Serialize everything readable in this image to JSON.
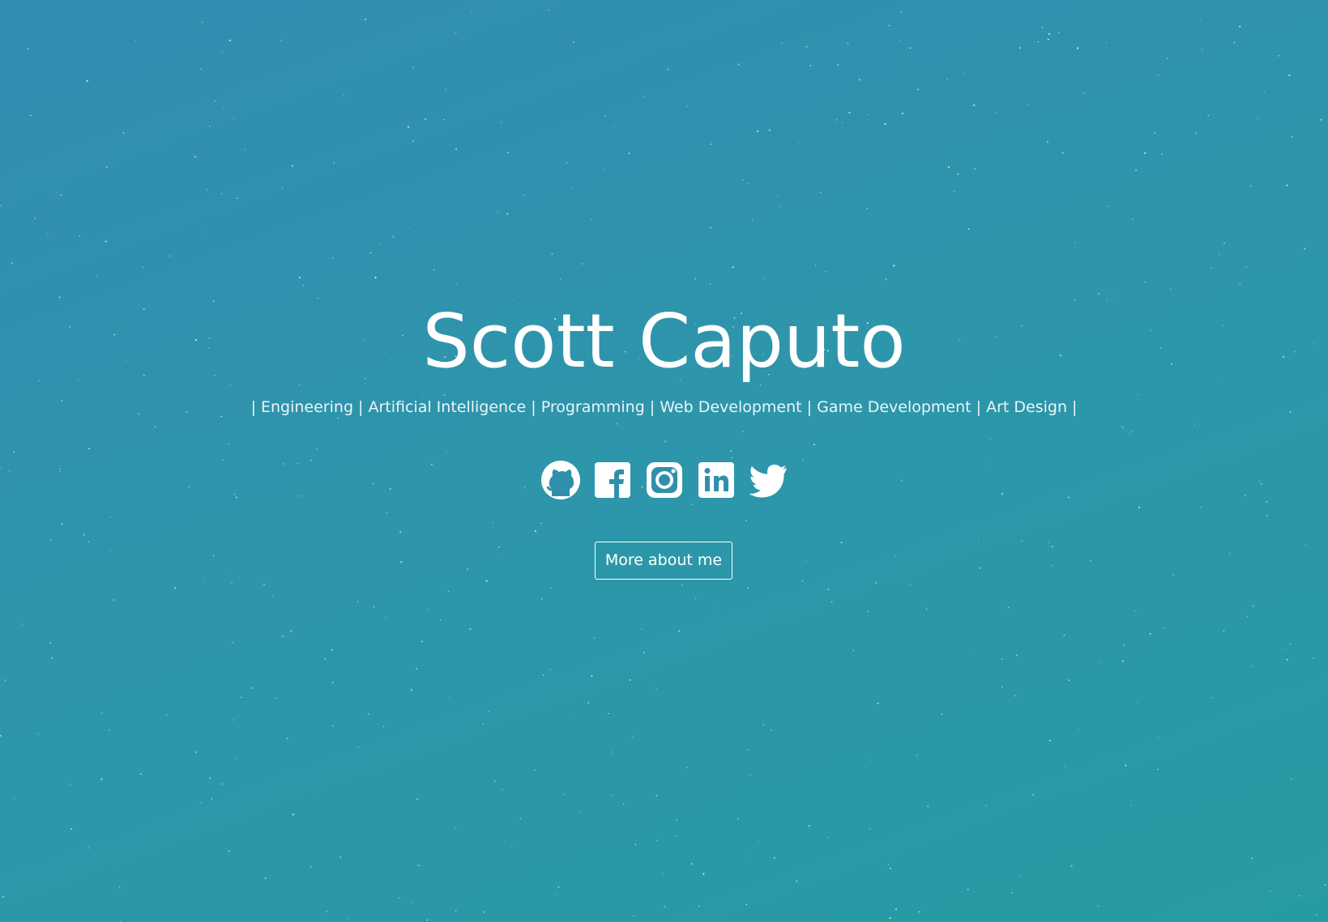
{
  "hero": {
    "name": "Scott Caputo",
    "tagline": "| Engineering | Artificial Intelligence | Programming | Web Development | Game Development | Art Design |",
    "button_label": "More about me"
  },
  "socials": [
    {
      "name": "GitHub",
      "icon": "github-icon"
    },
    {
      "name": "Facebook",
      "icon": "facebook-icon"
    },
    {
      "name": "Instagram",
      "icon": "instagram-icon"
    },
    {
      "name": "LinkedIn",
      "icon": "linkedin-icon"
    },
    {
      "name": "Twitter",
      "icon": "twitter-icon"
    }
  ],
  "colors": {
    "background_start": "#338db2",
    "background_end": "#279ba3",
    "foreground": "#ffffff"
  }
}
